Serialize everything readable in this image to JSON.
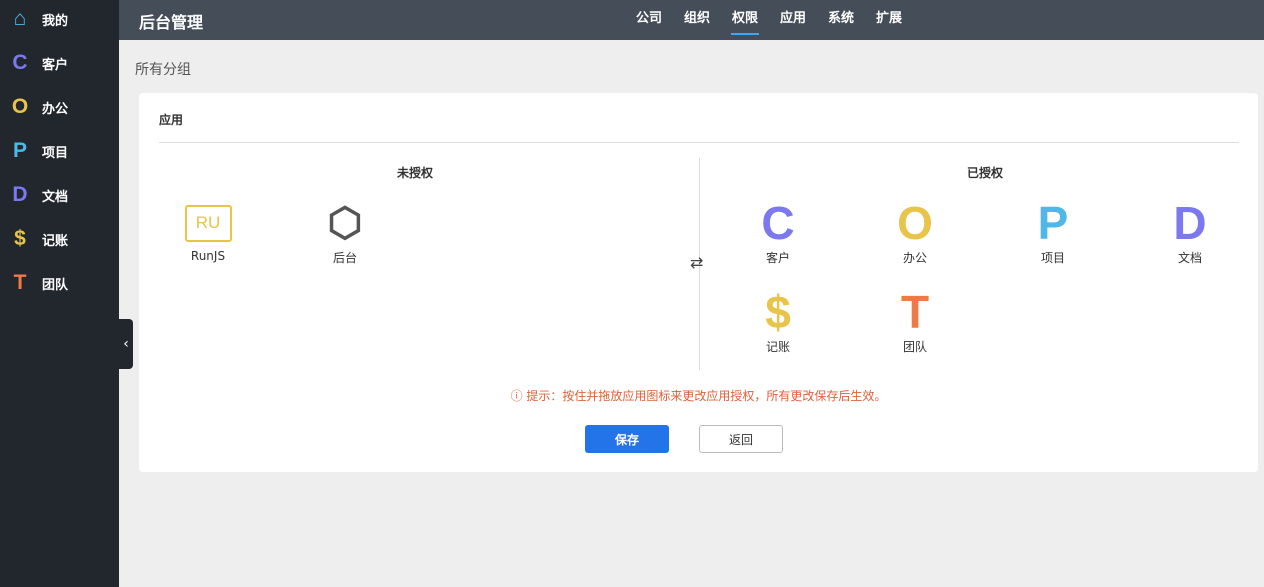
{
  "sidebar": {
    "items": [
      {
        "label": "我的",
        "icon": "home-icon",
        "glyph": "⌂",
        "color": "#4fb8e8"
      },
      {
        "label": "客户",
        "icon": "c-icon",
        "glyph": "C",
        "color": "#7b78f0"
      },
      {
        "label": "办公",
        "icon": "o-icon",
        "glyph": "O",
        "color": "#e8c54a"
      },
      {
        "label": "项目",
        "icon": "p-icon",
        "glyph": "P",
        "color": "#4fb8e8"
      },
      {
        "label": "文档",
        "icon": "d-icon",
        "glyph": "D",
        "color": "#7b78f0"
      },
      {
        "label": "记账",
        "icon": "dollar-icon",
        "glyph": "$",
        "color": "#e8c54a"
      },
      {
        "label": "团队",
        "icon": "t-icon",
        "glyph": "T",
        "color": "#f07a45"
      }
    ]
  },
  "header": {
    "title": "后台管理",
    "nav": [
      "公司",
      "组织",
      "权限",
      "应用",
      "系统",
      "扩展"
    ],
    "active": "权限"
  },
  "breadcrumb": "所有分组",
  "card": {
    "title": "应用",
    "unauthorized_title": "未授权",
    "authorized_title": "已授权",
    "unauthorized": [
      {
        "label": "RunJS",
        "glyph": "RU"
      },
      {
        "label": "后台",
        "glyph": "⬡"
      }
    ],
    "authorized": [
      {
        "label": "客户",
        "glyph": "C",
        "color": "#7b78f0"
      },
      {
        "label": "办公",
        "glyph": "O",
        "color": "#e8c54a"
      },
      {
        "label": "项目",
        "glyph": "P",
        "color": "#4fb8e8"
      },
      {
        "label": "文档",
        "glyph": "D",
        "color": "#7b78f0"
      },
      {
        "label": "记账",
        "glyph": "$",
        "color": "#e8c54a"
      },
      {
        "label": "团队",
        "glyph": "T",
        "color": "#f07a45"
      }
    ],
    "swap_glyph": "⇄",
    "tip": "ⓘ 提示：按住并拖放应用图标来更改应用授权，所有更改保存后生效。",
    "save": "保存",
    "back": "返回"
  }
}
